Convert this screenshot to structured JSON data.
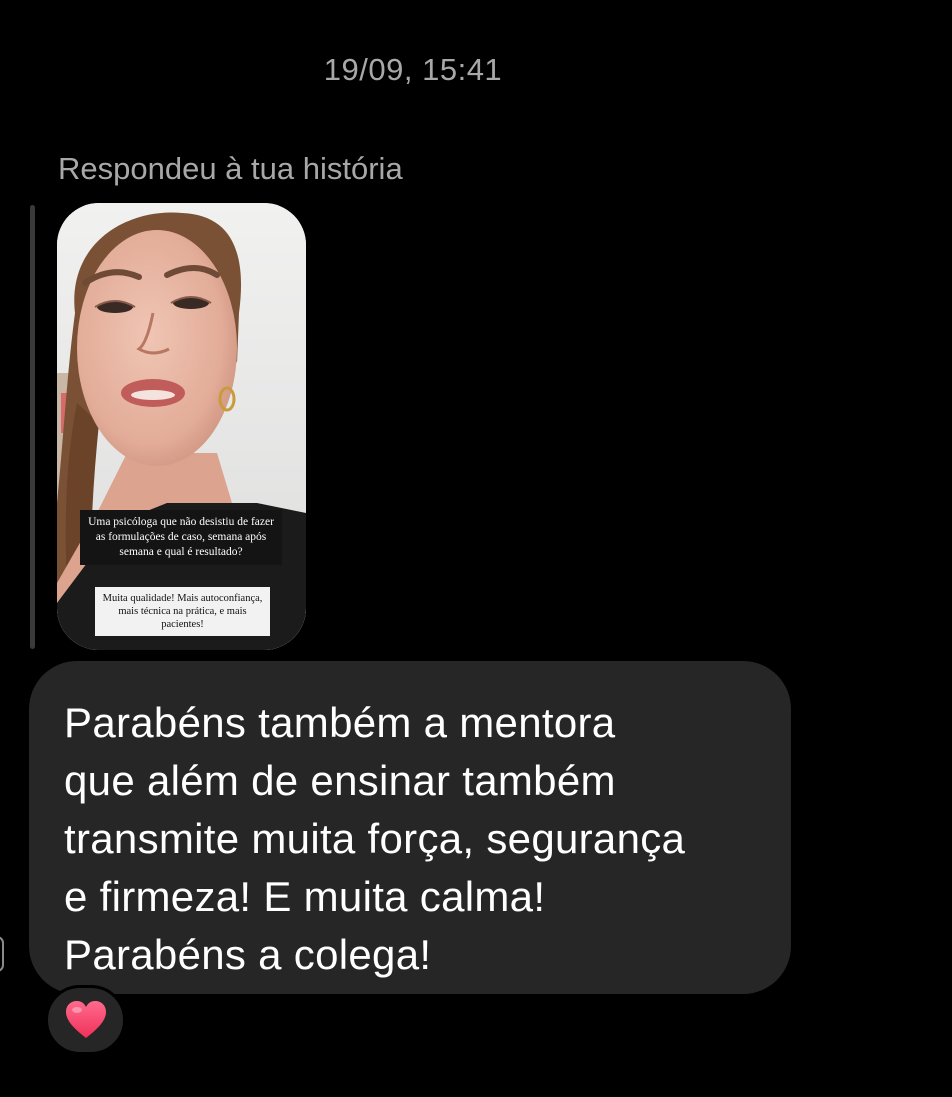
{
  "header": {
    "timestamp": "19/09, 15:41"
  },
  "story_reply": {
    "label": "Respondeu à tua história",
    "story": {
      "question_text": "Uma psicóloga que não desistiu de fazer as formulações de caso, semana após semana e qual é resultado?",
      "answer_text": "Muita qualidade! Mais autoconfiança, mais técnica na prática, e mais pacientes!"
    }
  },
  "message": {
    "text": "Parabéns também a mentora\nque além de ensinar também\ntransmite muita força, segurança\ne firmeza! E muita calma!\nParabéns a colega!"
  },
  "reaction": {
    "icon": "heart-icon",
    "color": "#ff3b6b"
  },
  "colors": {
    "background": "#000000",
    "bubble": "#262626",
    "meta_text": "#a8a8a8"
  }
}
